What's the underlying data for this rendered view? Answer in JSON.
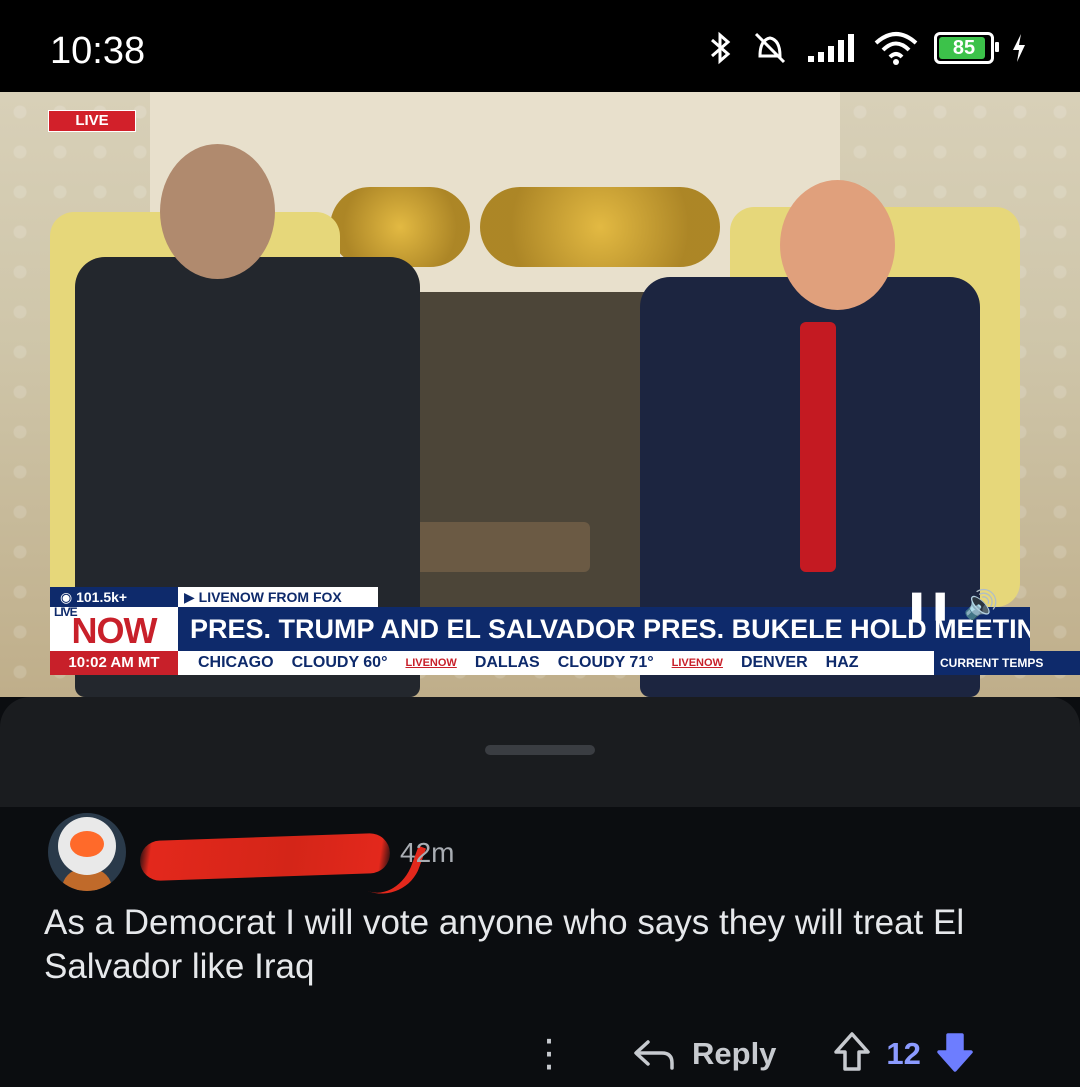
{
  "status_bar": {
    "time": "10:38",
    "battery_percent": "85",
    "battery_level": 0.85,
    "icons": [
      "bluetooth-icon",
      "silent-bell-icon",
      "signal-icon",
      "wifi-icon",
      "battery-icon",
      "charging-icon"
    ]
  },
  "video": {
    "live_badge": "LIVE",
    "viewers": "101.5k+",
    "source_label": "LIVENOW FROM FOX",
    "logo_small": "LIVE",
    "logo_big": "NOW",
    "headline": "PRES. TRUMP AND EL SALVADOR PRES. BUKELE HOLD MEETING",
    "clock": "10:02 AM MT",
    "ticker": [
      {
        "city": "CHICAGO",
        "weather": "CLOUDY 60°"
      },
      {
        "city": "DALLAS",
        "weather": "CLOUDY 71°"
      },
      {
        "city": "DENVER",
        "weather": "HAZ"
      }
    ],
    "ticker_tag": "LIVENOW",
    "current_temps": "CURRENT TEMPS"
  },
  "comment": {
    "age": "42m",
    "text": "As a Democrat I will vote anyone who says they will treat El Salvador like Iraq",
    "reply_label": "Reply",
    "vote_count": "12"
  },
  "colors": {
    "background": "#0b0d10",
    "upvote_count": "#8c9bff",
    "downvote_active": "#6d7dff",
    "redaction": "#e3281c",
    "fox_blue": "#0e2a6b",
    "fox_red": "#c8202a"
  }
}
